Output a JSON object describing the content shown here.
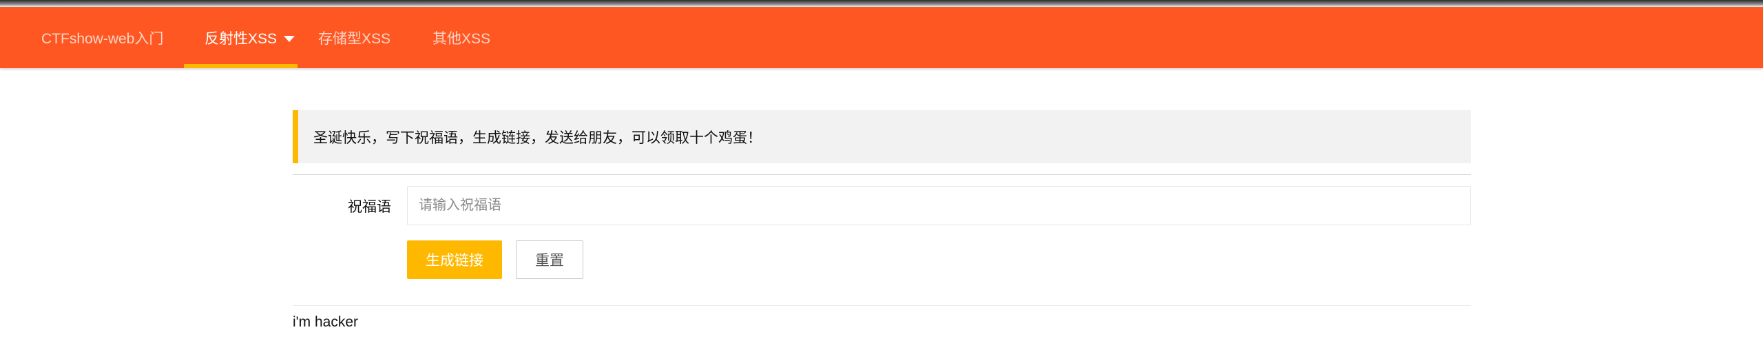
{
  "nav": {
    "items": [
      {
        "label": "CTFshow-web入门"
      },
      {
        "label": "反射性XSS"
      },
      {
        "label": "存储型XSS"
      },
      {
        "label": "其他XSS"
      }
    ],
    "active_index": 1,
    "accent_color": "#ff5722",
    "active_indicator_color": "#ffb800",
    "dropdown_icon": "caret-down"
  },
  "notice": {
    "text": "圣诞快乐，写下祝福语，生成链接，发送给朋友，可以领取十个鸡蛋！"
  },
  "form": {
    "label": "祝福语",
    "input_value": "",
    "input_placeholder": "请输入祝福语",
    "submit_label": "生成链接",
    "reset_label": "重置"
  },
  "output": {
    "text": "i'm hacker"
  }
}
